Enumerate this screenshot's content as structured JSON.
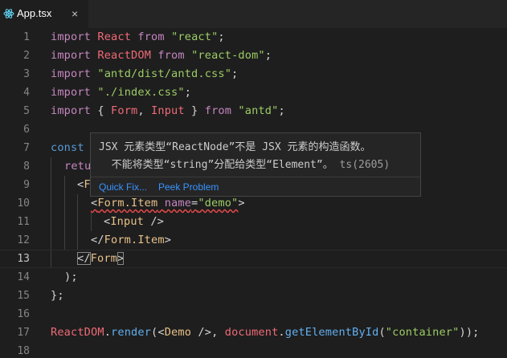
{
  "tab": {
    "title": "App.tsx",
    "close": "×"
  },
  "editor": {
    "line_numbers": [
      "1",
      "2",
      "3",
      "4",
      "5",
      "6",
      "7",
      "8",
      "9",
      "10",
      "11",
      "12",
      "13",
      "14",
      "15",
      "16",
      "17",
      "18"
    ],
    "active_line": "13",
    "lines": {
      "l1": {
        "import": "import",
        "name": "React",
        "from": "from",
        "src": "\"react\"",
        "semi": ";"
      },
      "l2": {
        "import": "import",
        "name": "ReactDOM",
        "from": "from",
        "src": "\"react-dom\"",
        "semi": ";"
      },
      "l3": {
        "import": "import",
        "src": "\"antd/dist/antd.css\"",
        "semi": ";"
      },
      "l4": {
        "import": "import",
        "src": "\"./index.css\"",
        "semi": ";"
      },
      "l5": {
        "import": "import",
        "open": "{ ",
        "a": "Form",
        "comma": ", ",
        "b": "Input",
        "close": " }",
        "from": "from",
        "src": "\"antd\"",
        "semi": ";"
      },
      "l7": {
        "const": "const"
      },
      "l8": {
        "ret": "retu"
      },
      "l9": {
        "open": "<",
        "tag": "F"
      },
      "l10": {
        "open": "<",
        "tag": "Form.Item",
        "attr": "name",
        "eq": "=",
        "val": "\"demo\"",
        "close": ">"
      },
      "l11": {
        "open": "<",
        "tag": "Input",
        "close": " />"
      },
      "l12": {
        "open": "</",
        "tag": "Form.Item",
        "close": ">"
      },
      "l13": {
        "open": "</",
        "tag": "Form",
        "close": ">"
      },
      "l14": {
        "text": ");"
      },
      "l15": {
        "text": "};"
      },
      "l17": {
        "obj": "ReactDOM",
        "dot": ".",
        "fn": "render",
        "p1": "(<",
        "tag": "Demo",
        "p2": " />, ",
        "doc": "document",
        "dot2": ".",
        "fn2": "getElementById",
        "p3": "(",
        "str": "\"container\"",
        "p4": "));"
      }
    }
  },
  "hover": {
    "message_line1": "JSX 元素类型“ReactNode”不是 JSX 元素的构造函数。",
    "message_line2": "  不能将类型“string”分配给类型“Element”。",
    "code": "ts(2605)",
    "quick_fix": "Quick Fix...",
    "peek_problem": "Peek Problem"
  },
  "colors": {
    "background": "#1e1e1e",
    "tab_bar": "#252526",
    "error_squiggle": "#f14c4c",
    "link": "#3794ff"
  }
}
